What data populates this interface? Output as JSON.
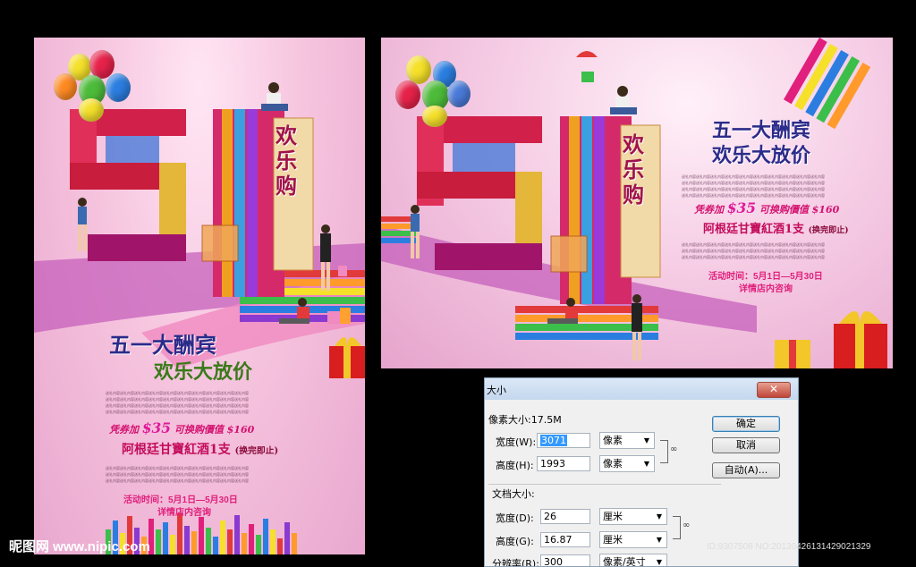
{
  "poster": {
    "shape_text": "欢乐购",
    "headline": "五一大酬宾",
    "subhead": "欢乐大放价",
    "coupon_prefix": "凭券加",
    "coupon_amount": "$35",
    "coupon_suffix": "可换购價值 $160",
    "wine_line": "阿根廷甘寶紅酒1支",
    "wine_note": "(换完即止)",
    "event_time": "活动时间：5月1日—5月30日",
    "event_detail": "详情店内咨询",
    "filler_line": "送礼内容送礼内容送礼内容送礼内容送礼内容送礼内容送礼内容送礼内容送礼内容送礼内容"
  },
  "dialog": {
    "title": "大小",
    "close_label": "✕",
    "pixel_size_label": "像素大小:17.5M",
    "width_label": "宽度(W):",
    "width_value": "3071",
    "width_unit": "像素",
    "height_label": "高度(H):",
    "height_value": "1993",
    "height_unit": "像素",
    "doc_size_label": "文档大小:",
    "doc_width_label": "宽度(D):",
    "doc_width_value": "26",
    "doc_width_unit": "厘米",
    "doc_height_label": "高度(G):",
    "doc_height_value": "16.87",
    "doc_height_unit": "厘米",
    "resolution_label": "分辨率(R):",
    "resolution_value": "300",
    "resolution_unit": "像素/英寸",
    "ok_label": "确定",
    "cancel_label": "取消",
    "auto_label": "自动(A)..."
  },
  "watermark": {
    "left": "昵图网 www.nipic.com",
    "right": "ID:9307508 NO:20130426131429021329"
  },
  "colors": {
    "page_bg": "#000000",
    "poster_pink": "#f4c8e2",
    "title_blue": "#2b2b8a",
    "accent_magenta": "#e0207c"
  }
}
